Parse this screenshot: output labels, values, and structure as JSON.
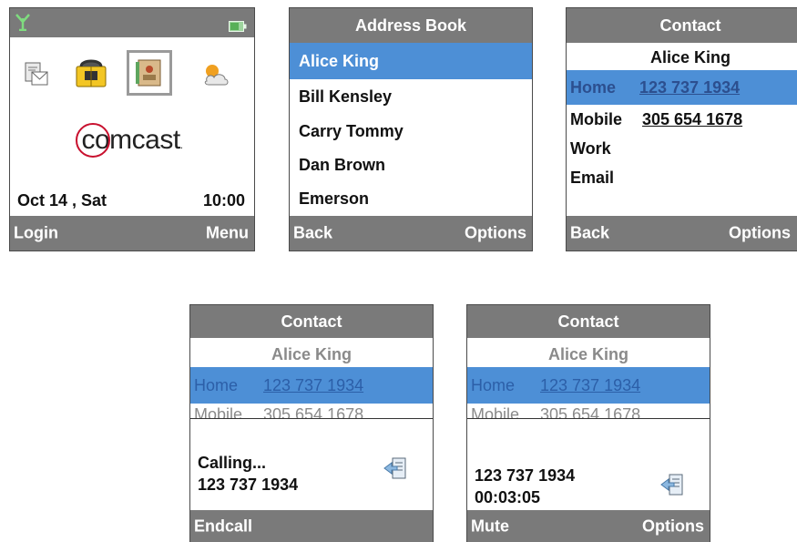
{
  "screen1": {
    "date": "Oct 14 , Sat",
    "time": "10:00",
    "brand": "comcast",
    "soft_left": "Login",
    "soft_right": "Menu"
  },
  "screen2": {
    "title": "Address Book",
    "items": [
      "Alice King",
      "Bill Kensley",
      "Carry Tommy",
      "Dan Brown",
      "Emerson"
    ],
    "soft_left": "Back",
    "soft_right": "Options"
  },
  "screen3": {
    "title": "Contact",
    "name": "Alice King",
    "home_label": "Home",
    "home_number": "123 737 1934",
    "mobile_label": "Mobile",
    "mobile_number": "305 654 1678",
    "work_label": "Work",
    "email_label": "Email",
    "soft_left": "Back",
    "soft_right": "Options"
  },
  "screen4": {
    "title": "Contact",
    "name": "Alice King",
    "home_label": "Home",
    "home_number": "123 737 1934",
    "mobile_label": "Mobile",
    "mobile_number": "305 654 1678",
    "status": "Calling...",
    "number": "123 737 1934",
    "soft_left": "Endcall"
  },
  "screen5": {
    "title": "Contact",
    "name": "Alice King",
    "home_label": "Home",
    "home_number": "123 737 1934",
    "mobile_label": "Mobile",
    "mobile_number": "305 654 1678",
    "number": "123 737 1934",
    "duration": "00:03:05",
    "soft_left": "Mute",
    "soft_right": "Options"
  }
}
